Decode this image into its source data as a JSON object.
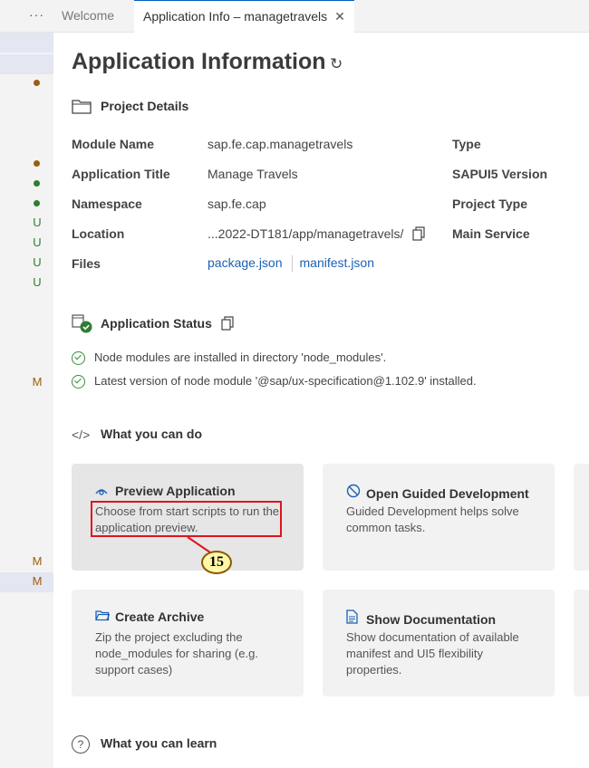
{
  "tabs": {
    "more": "···",
    "welcome": "Welcome",
    "active": "Application Info – managetravels",
    "close": "✕"
  },
  "gutter_marks": [
    "U",
    "U",
    "U",
    "U",
    "M",
    "M",
    "M"
  ],
  "header": {
    "title": "Application Information",
    "refresh_icon": "↻"
  },
  "project_details": {
    "heading": "Project Details",
    "fields": {
      "module_name_label": "Module Name",
      "module_name_value": "sap.fe.cap.managetravels",
      "app_title_label": "Application Title",
      "app_title_value": "Manage Travels",
      "namespace_label": "Namespace",
      "namespace_value": "sap.fe.cap",
      "location_label": "Location",
      "location_value": "...2022-DT181/app/managetravels/",
      "files_label": "Files",
      "file_package": "package.json",
      "file_manifest": "manifest.json",
      "type_label": "Type",
      "sapui5_label": "SAPUI5 Version",
      "project_type_label": "Project Type",
      "main_service_label": "Main Service"
    }
  },
  "app_status": {
    "heading": "Application Status",
    "lines": [
      "Node modules are installed in directory 'node_modules'.",
      "Latest version of node module '@sap/ux-specification@1.102.9' installed."
    ]
  },
  "what_you_can_do": {
    "heading": "What you can do",
    "heading_icon": "</>",
    "cards": [
      {
        "title": "Preview Application",
        "desc": "Choose from start scripts to run the application preview."
      },
      {
        "title": "Open Guided Development",
        "desc": "Guided Development helps solve common tasks."
      },
      {
        "title": "Create Archive",
        "desc": "Zip the project excluding the node_modules for sharing (e.g. support cases)"
      },
      {
        "title": "Show Documentation",
        "desc": "Show documentation of available manifest and UI5 flexibility properties."
      }
    ]
  },
  "what_you_can_learn": {
    "heading": "What you can learn",
    "icon": "?"
  },
  "annotation": {
    "number": "15"
  },
  "colors": {
    "link": "#1a62b4",
    "highlight": "#e0141e",
    "callout_fill": "#fff8a8"
  }
}
